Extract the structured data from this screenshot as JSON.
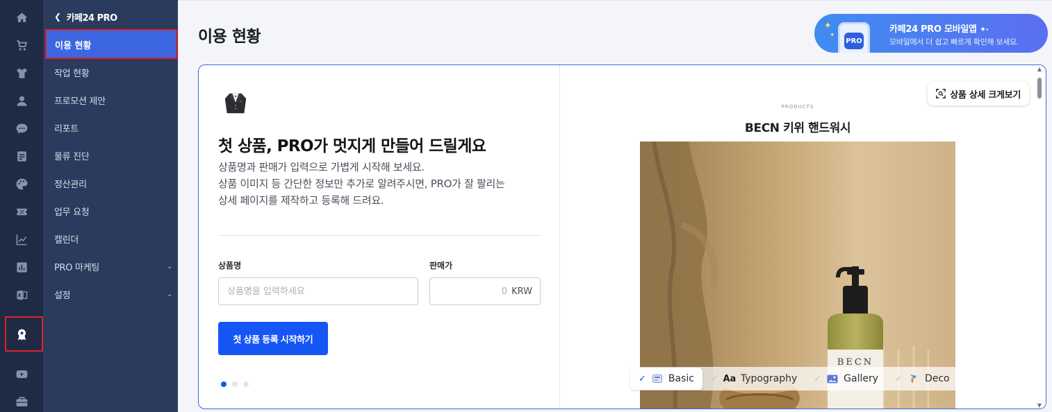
{
  "rail": {
    "icons": [
      "home-icon",
      "cart-icon",
      "shirt-icon",
      "user-icon",
      "chat-icon",
      "document-icon",
      "palette-icon",
      "coupon-icon",
      "trend-chart-icon",
      "bar-chart-icon",
      "excel-icon",
      "pro-badge-icon",
      "youtube-icon",
      "briefcase-icon"
    ],
    "active": "pro-badge-icon"
  },
  "sidenav": {
    "back_label": "카페24 PRO",
    "items": [
      {
        "label": "이용 현황",
        "active": true
      },
      {
        "label": "작업 현황"
      },
      {
        "label": "프로모션 제안"
      },
      {
        "label": "리포트"
      },
      {
        "label": "물류 진단"
      },
      {
        "label": "정산관리"
      },
      {
        "label": "업무 요청"
      },
      {
        "label": "캘린더"
      },
      {
        "label": "PRO 마케팅",
        "expandable": true
      },
      {
        "label": "설정",
        "expandable": true
      }
    ]
  },
  "header": {
    "title": "이용 현황"
  },
  "promo": {
    "badge": "PRO",
    "title": "카페24 PRO 모바일앱",
    "subtitle": "모바일에서 더 쉽고 빠르게 확인해 보세요."
  },
  "onboarding": {
    "headline": "첫 상품, PRO가 멋지게 만들어 드릴게요",
    "desc_line1": "상품명과 판매가 입력으로 가볍게 시작해 보세요.",
    "desc_line2": "상품 이미지 등 간단한 정보만 추가로 알려주시면, PRO가 잘 팔리는",
    "desc_line3": "상세 페이지를 제작하고 등록해 드려요.",
    "name_label": "상품명",
    "name_placeholder": "상품명을 입력하세요",
    "price_label": "판매가",
    "price_value": "0",
    "price_currency": "KRW",
    "cta_label": "첫 상품 등록 시작하기",
    "slide_index": 0,
    "slide_count": 3
  },
  "preview": {
    "overline": "PRODUCTS",
    "product_title": "BECN 키위 핸드워시",
    "bottle_text": "BECN",
    "zoom_label": "상품 상세 크게보기",
    "templates": [
      {
        "label": "Basic",
        "selected": true,
        "icon": "basic-template-icon"
      },
      {
        "label": "Typography",
        "selected": false,
        "icon": "typography-icon"
      },
      {
        "label": "Gallery",
        "selected": false,
        "icon": "gallery-icon"
      },
      {
        "label": "Deco",
        "selected": false,
        "icon": "deco-icon"
      }
    ],
    "typography_glyph": "Aa"
  },
  "colors": {
    "accent": "#1556f5",
    "nav_active": "#3c67e0",
    "highlight": "#e0202a",
    "rail_bg": "#1f2b45",
    "sidenav_bg": "#2b3b5e"
  }
}
